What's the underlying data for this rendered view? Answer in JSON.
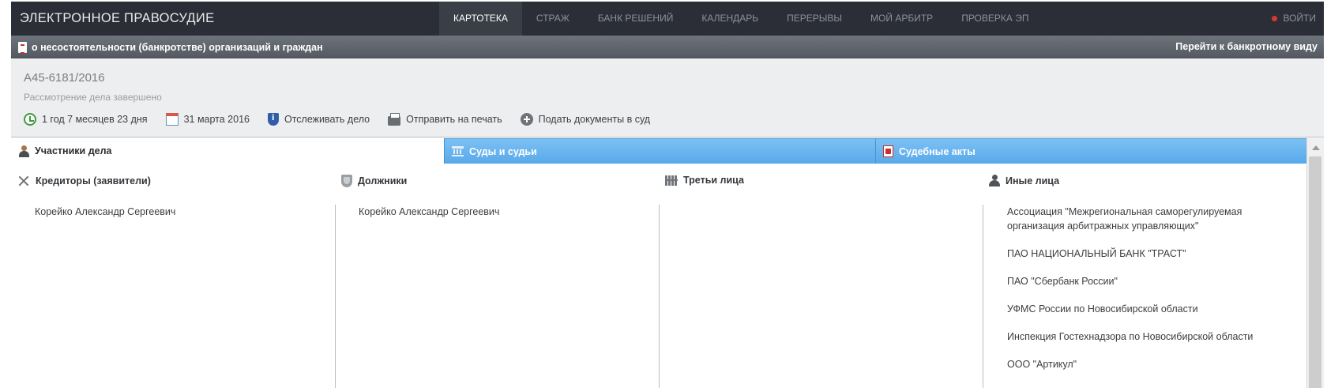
{
  "topbar": {
    "brand": "ЭЛЕКТРОННОЕ ПРАВОСУДИЕ",
    "nav": [
      {
        "label": "КАРТОТЕКА",
        "active": true
      },
      {
        "label": "СТРАЖ",
        "active": false
      },
      {
        "label": "БАНК РЕШЕНИЙ",
        "active": false
      },
      {
        "label": "КАЛЕНДАРЬ",
        "active": false
      },
      {
        "label": "ПЕРЕРЫВЫ",
        "active": false
      },
      {
        "label": "МОЙ АРБИТР",
        "active": false
      },
      {
        "label": "ПРОВЕРКА ЭП",
        "active": false
      }
    ],
    "login_label": "ВОЙТИ"
  },
  "subheader": {
    "category": "о несостоятельности (банкротстве) организаций и граждан",
    "bankrupt_view_link": "Перейти к банкротному виду"
  },
  "case": {
    "number": "А45-6181/2016",
    "status": "Рассмотрение дела завершено",
    "actions": {
      "duration": "1 год 7 месяцев 23 дня",
      "date": "31 марта 2016",
      "track": "Отслеживать дело",
      "print": "Отправить на печать",
      "submit": "Подать документы в суд"
    }
  },
  "tabs": {
    "participants": "Участники дела",
    "courts": "Суды и судьи",
    "acts": "Судебные акты"
  },
  "columns": {
    "creditors": {
      "title": "Кредиторы (заявители)",
      "items": [
        "Корейко Александр Сергеевич"
      ]
    },
    "debtors": {
      "title": "Должники",
      "items": [
        "Корейко Александр Сергеевич"
      ]
    },
    "third": {
      "title": "Третьи лица",
      "items": []
    },
    "others": {
      "title": "Иные лица",
      "items": [
        "Ассоциация \"Межрегиональная саморегулируемая организация арбитражных управляющих\"",
        "ПАО НАЦИОНАЛЬНЫЙ БАНК \"ТРАСТ\"",
        "ПАО \"Сбербанк России\"",
        "УФМС России по Новосибирской области",
        "Инспекция Гостехнадзора по Новосибирской области",
        "ООО \"Артикул\""
      ]
    }
  },
  "colors": {
    "topbar_bg": "#2b2e37",
    "tab_blue": "#58a9ea",
    "login_dot": "#d83a32"
  }
}
